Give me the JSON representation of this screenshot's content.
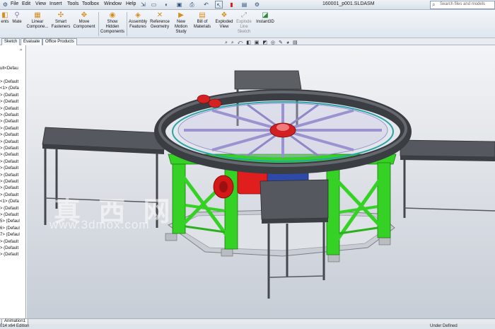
{
  "menubar": {
    "items": [
      "File",
      "Edit",
      "View",
      "Insert",
      "Tools",
      "Toolbox",
      "Window",
      "Help"
    ],
    "document_title": "160001_p001.SLDASM",
    "search_placeholder": "Search files and models"
  },
  "ribbon": {
    "buttons": [
      {
        "label": "ents",
        "icon": "components-icon",
        "enabled": true
      },
      {
        "label": "Mate",
        "icon": "mate-icon",
        "enabled": true
      },
      {
        "label": "Linear\nCompone...",
        "icon": "linear-pattern-icon",
        "enabled": true
      },
      {
        "label": "Smart\nFasteners",
        "icon": "smart-fasteners-icon",
        "enabled": true
      },
      {
        "label": "Move\nComponent",
        "icon": "move-component-icon",
        "enabled": true
      },
      {
        "label": "Show\nHidden\nComponents",
        "icon": "show-hidden-icon",
        "enabled": true
      },
      {
        "label": "Assembly\nFeatures",
        "icon": "assembly-features-icon",
        "enabled": true
      },
      {
        "label": "Reference\nGeometry",
        "icon": "reference-geometry-icon",
        "enabled": true
      },
      {
        "label": "New\nMotion\nStudy",
        "icon": "motion-study-icon",
        "enabled": true
      },
      {
        "label": "Bill of\nMaterials",
        "icon": "bill-of-materials-icon",
        "enabled": true
      },
      {
        "label": "Exploded\nView",
        "icon": "exploded-view-icon",
        "enabled": true
      },
      {
        "label": "Explode\nLine\nSketch",
        "icon": "explode-line-icon",
        "enabled": false
      },
      {
        "label": "Instant3D",
        "icon": "instant3d-icon",
        "enabled": true
      }
    ]
  },
  "tabs": [
    "Sketch",
    "Evaluate",
    "Office Products"
  ],
  "feature_tree": {
    "header": "ult<Defau",
    "rows": [
      "> (Default",
      "<1> (Defa",
      "> (Default",
      "> (Default",
      "> (Default",
      "> (Default",
      "> (Default",
      "> (Default",
      "> (Default",
      "> (Default",
      "> (Default",
      "> (Default",
      "> (Default",
      "> (Default",
      "> (Default",
      "> (Default",
      "> (Default",
      "> (Default",
      "<1> (Defa",
      "> (Default",
      "> (Default",
      "5> (Defaul",
      "6> (Defaul",
      "7> (Defaul",
      "> (Default",
      "> (Default",
      "> (Default"
    ]
  },
  "watermark": {
    "line1": "真 西 网",
    "line2": "www.3dmox.com"
  },
  "bottom_tab": "Animation1",
  "status": {
    "left": "014 x64 Edition",
    "right": "Under Defined"
  },
  "colors": {
    "frame_green": "#35d225",
    "motor_red": "#e01e1e",
    "gearbox_blue": "#2f49a8",
    "steel_gray": "#55595f",
    "conveyor_purple": "#9a93cf"
  }
}
